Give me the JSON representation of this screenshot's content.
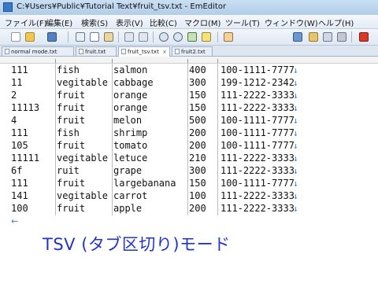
{
  "window": {
    "title": "C:¥Users¥Public¥Tutorial Text¥fruit_tsv.txt - EmEditor"
  },
  "menu": [
    "ファイル(F)",
    "編集(E)",
    "検索(S)",
    "表示(V)",
    "比較(C)",
    "マクロ(M)",
    "ツール(T)",
    "ウィンドウ(W)",
    "ヘルプ(H)"
  ],
  "toolbar": {
    "buttons": [
      "new-icon",
      "open-icon",
      "save-icon",
      "cut-icon",
      "copy-icon",
      "paste-icon",
      "undo-icon",
      "redo-icon",
      "find-icon",
      "find-next-icon",
      "replace-icon",
      "highlight-icon",
      "macro-icon",
      "settings-icon",
      "config-icon",
      "record-icon"
    ]
  },
  "tabs": [
    {
      "label": "normal mode.txt",
      "active": false
    },
    {
      "label": "fruit.txt",
      "active": false
    },
    {
      "label": "fruit_tsv.txt",
      "active": true
    },
    {
      "label": "fruit2.txt",
      "active": false
    }
  ],
  "tab_close_glyph": "x",
  "rows": [
    [
      "111",
      "fish",
      "salmon",
      "400",
      "100-1111-7777"
    ],
    [
      "11",
      "vegitable",
      "cabbage",
      "300",
      "199-1212-2342"
    ],
    [
      "2",
      "fruit",
      "orange",
      "150",
      "111-2222-3333"
    ],
    [
      "11113",
      "fruit",
      "orange",
      "150",
      "111-2222-3333"
    ],
    [
      "4",
      "fruit",
      "melon",
      "500",
      "100-1111-7777"
    ],
    [
      "111",
      "fish",
      "shrimp",
      "200",
      "100-1111-7777"
    ],
    [
      "105",
      "fruit",
      "tomato",
      "200",
      "100-1111-7777"
    ],
    [
      "11111",
      "vegitable",
      "letuce",
      "210",
      "111-2222-3333"
    ],
    [
      "6f",
      "ruit",
      "grape",
      "300",
      "111-2222-3333"
    ],
    [
      "111",
      "fruit",
      "largebanana",
      "150",
      "100-1111-7777"
    ],
    [
      "141",
      "vegitable",
      "carrot",
      "100",
      "111-2222-3333"
    ],
    [
      "100",
      "fruit",
      "apple",
      "200",
      "111-2222-3333"
    ]
  ],
  "eol_marker": "↓",
  "eof_marker": "←",
  "caption": "TSV (タブ区切り)モード",
  "colors": {
    "marker": "#3b7ad8",
    "caption": "#2233cc"
  }
}
